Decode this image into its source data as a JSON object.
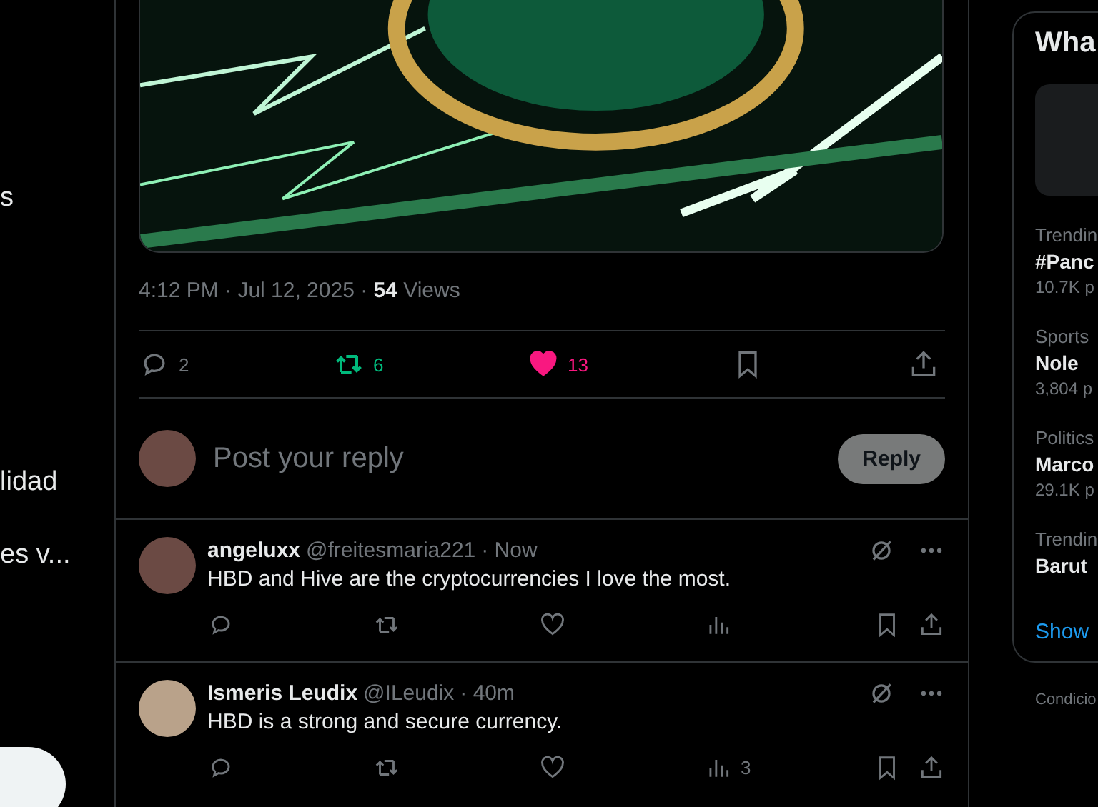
{
  "left_nav": {
    "items": [
      {
        "label": "s"
      },
      {
        "label": "lidad"
      },
      {
        "label": "es v..."
      }
    ]
  },
  "post": {
    "timestamp": "4:12 PM · Jul 12, 2025 · ",
    "views_count": "54",
    "views_label": " Views",
    "actions": [
      {
        "kind": "reply",
        "count": "2",
        "active": false
      },
      {
        "kind": "repost",
        "count": "6",
        "active": true
      },
      {
        "kind": "like",
        "count": "13",
        "active": true
      },
      {
        "kind": "bookmark",
        "active": false
      },
      {
        "kind": "share",
        "active": false
      }
    ]
  },
  "composer": {
    "placeholder": "Post your reply",
    "button": "Reply"
  },
  "replies": [
    {
      "name": "angeluxx",
      "handle": "@freitesmaria221",
      "time": "· Now",
      "text": "HBD and Hive are the cryptocurrencies I love the most."
    },
    {
      "name": "Ismeris Leudix",
      "handle": "@ILeudix",
      "time": "· 40m",
      "text": "HBD is a strong and secure currency.",
      "views": "3"
    }
  ],
  "trends": {
    "title": "Wha",
    "items": [
      {
        "category": "Trendin",
        "name": "#Panc",
        "posts": "10.7K p"
      },
      {
        "category": "Sports",
        "name": "Nole",
        "posts": "3,804 p"
      },
      {
        "category": "Politics",
        "name": "Marco",
        "posts": "29.1K p"
      },
      {
        "category": "Trendin",
        "name": "Barut"
      }
    ],
    "show_more": "Show"
  },
  "footer": {
    "links": [
      "Condicio"
    ]
  }
}
